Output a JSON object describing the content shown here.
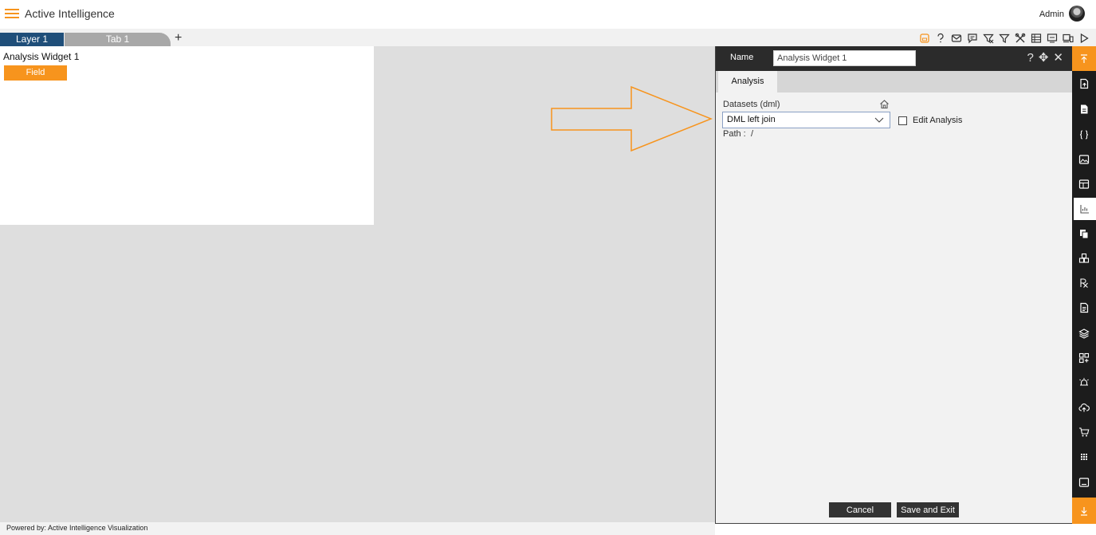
{
  "header": {
    "app_title": "Active Intelligence",
    "user_name": "Admin"
  },
  "tabs": {
    "layer_label": "Layer 1",
    "tab_label": "Tab 1",
    "add_label": "+"
  },
  "toolbar": {
    "icons": [
      "save-icon",
      "help-icon",
      "mail-icon",
      "comment-icon",
      "clear-filter-icon",
      "filter-icon",
      "tools-icon",
      "grid-icon",
      "screen-icon",
      "devices-icon",
      "play-icon"
    ]
  },
  "widget": {
    "title": "Analysis Widget 1",
    "field_button": "Field"
  },
  "panel": {
    "name_label": "Name",
    "name_value": "Analysis Widget 1",
    "tab_label": "Analysis",
    "datasets_label": "Datasets (dml)",
    "dataset_selected": "DML left join",
    "edit_analysis_label": "Edit Analysis",
    "path_label": "Path :",
    "path_value": "/",
    "cancel_label": "Cancel",
    "save_label": "Save and Exit"
  },
  "rail": {
    "icons": [
      "export-icon",
      "document-icon",
      "braces-icon",
      "image-icon",
      "table-icon",
      "chart-icon",
      "copy-icon",
      "cubes-icon",
      "formula-icon",
      "report-icon",
      "layers-icon",
      "add-widget-icon",
      "alert-icon",
      "cloud-upload-icon",
      "cart-icon",
      "apps-icon",
      "screen-icon"
    ],
    "active_index": 5
  },
  "footer": {
    "text": "Powered by: Active Intelligence Visualization"
  },
  "colors": {
    "accent": "#f7941d",
    "layer_tab": "#1f4e79",
    "dark": "#2b2b2b"
  }
}
